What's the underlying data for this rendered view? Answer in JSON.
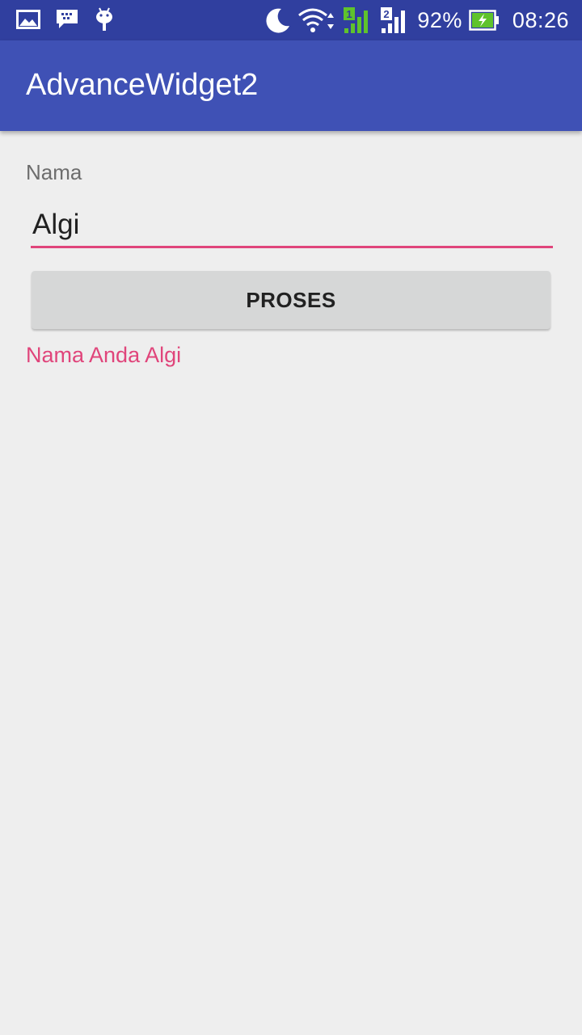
{
  "status_bar": {
    "left_icons": [
      "gallery-icon",
      "bbm-chat-icon",
      "android-debug-icon"
    ],
    "right_icons": [
      "do-not-disturb-moon-icon",
      "wifi-icon",
      "signal-sim1-icon",
      "signal-sim2-icon",
      "battery-charging-icon"
    ],
    "sim1_label": "1",
    "sim2_label": "2",
    "battery_percent": "92%",
    "time": "08:26",
    "colors": {
      "background": "#303f9f",
      "battery": "#5fc32c"
    }
  },
  "app_bar": {
    "title": "AdvanceWidget2",
    "color": "#3f51b5"
  },
  "form": {
    "name_label": "Nama",
    "name_value": "Algi",
    "accent_color": "#e0457b",
    "submit_label": "PROSES",
    "result_text": "Nama Anda Algi"
  }
}
